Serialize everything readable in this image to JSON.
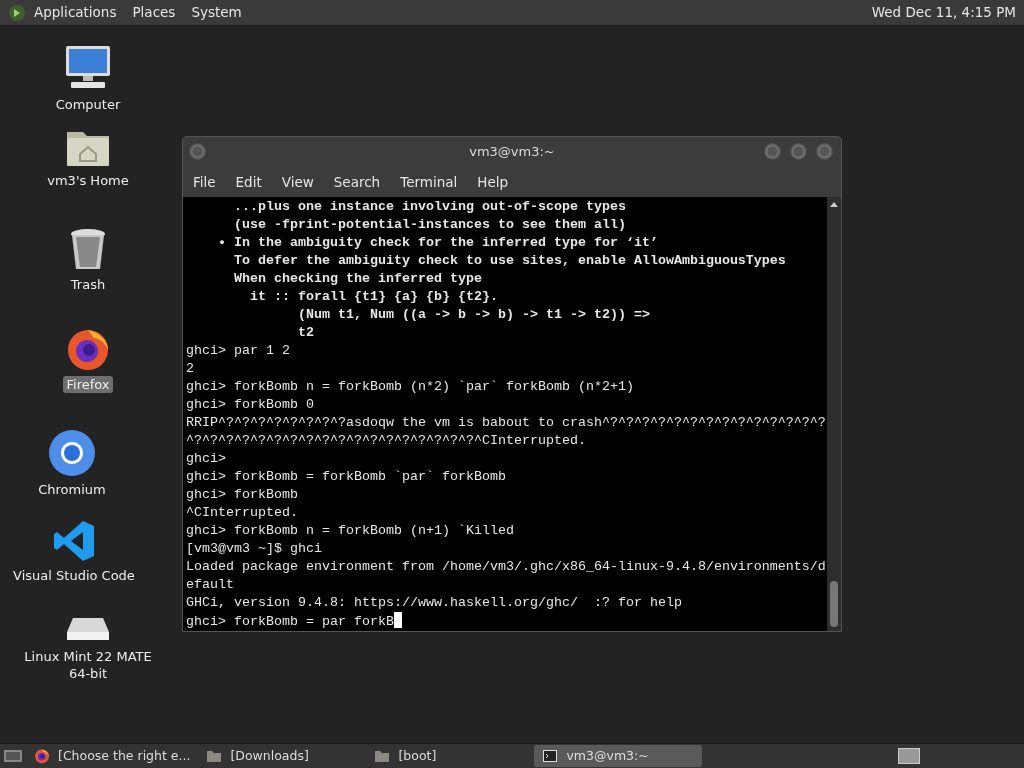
{
  "top_panel": {
    "menus": [
      "Applications",
      "Places",
      "System"
    ],
    "clock": "Wed Dec 11,  4:15 PM"
  },
  "desktop_icons": [
    {
      "kind": "computer",
      "label": "Computer",
      "selected": false
    },
    {
      "kind": "home",
      "label": "vm3's Home",
      "selected": false
    },
    {
      "kind": "trash",
      "label": "Trash",
      "selected": false
    },
    {
      "kind": "firefox",
      "label": "Firefox",
      "selected": true
    },
    {
      "kind": "chromium",
      "label": "Chromium",
      "selected": false
    },
    {
      "kind": "vscode",
      "label": "Visual Studio Code",
      "selected": false
    },
    {
      "kind": "drive",
      "label": "Linux Mint 22 MATE 64-bit",
      "selected": false
    }
  ],
  "window": {
    "title": "vm3@vm3:~",
    "menu": [
      "File",
      "Edit",
      "View",
      "Search",
      "Terminal",
      "Help"
    ],
    "terminal": {
      "cursor": true,
      "lines": [
        {
          "text": "      ...plus one instance involving out-of-scope types",
          "bold": true
        },
        {
          "text": "      (use -fprint-potential-instances to see them all)",
          "bold": true
        },
        {
          "text": "    • In the ambiguity check for the inferred type for ‘it’",
          "bold": true
        },
        {
          "text": "      To defer the ambiguity check to use sites, enable AllowAmbiguousTypes",
          "bold": true
        },
        {
          "text": "      When checking the inferred type",
          "bold": true
        },
        {
          "text": "        it :: forall {t1} {a} {b} {t2}.",
          "bold": true
        },
        {
          "text": "              (Num t1, Num ((a -> b -> b) -> t1 -> t2)) =>",
          "bold": true
        },
        {
          "text": "              t2",
          "bold": true
        },
        {
          "text": "ghci> par 1 2",
          "bold": false
        },
        {
          "text": "2",
          "bold": false
        },
        {
          "text": "ghci> forkBomb n = forkBomb (n*2) `par` forkBomb (n*2+1)",
          "bold": false
        },
        {
          "text": "ghci> forkBomb 0",
          "bold": false
        },
        {
          "text": "RRIP^?^?^?^?^?^?^?^?asdoqw the vm is babout to crash^?^?^?^?^?^?^?^?^?^?^?^?^?^?",
          "bold": false
        },
        {
          "text": "^?^?^?^?^?^?^?^?^?^?^?^?^?^?^?^?^?^?^CInterrupted.",
          "bold": false
        },
        {
          "text": "ghci>",
          "bold": false
        },
        {
          "text": "ghci> forkBomb = forkBomb `par` forkBomb",
          "bold": false
        },
        {
          "text": "ghci> forkBomb",
          "bold": false
        },
        {
          "text": "^CInterrupted.",
          "bold": false
        },
        {
          "text": "ghci> forkBomb n = forkBomb (n+1) `Killed",
          "bold": false
        },
        {
          "text": "[vm3@vm3 ~]$ ghci",
          "bold": false
        },
        {
          "text": "Loaded package environment from /home/vm3/.ghc/x86_64-linux-9.4.8/environments/d",
          "bold": false
        },
        {
          "text": "efault",
          "bold": false
        },
        {
          "text": "GHCi, version 9.4.8: https://www.haskell.org/ghc/  :? for help",
          "bold": false
        },
        {
          "text": "ghci> forkBomb = par forkB",
          "bold": false
        }
      ]
    }
  },
  "taskbar": {
    "items": [
      {
        "kind": "firefox",
        "label": "[Choose the right e...",
        "selected": false
      },
      {
        "kind": "folder",
        "label": "[Downloads]",
        "selected": false
      },
      {
        "kind": "folder",
        "label": "[boot]",
        "selected": false
      },
      {
        "kind": "terminal",
        "label": "vm3@vm3:~",
        "selected": true
      }
    ]
  }
}
